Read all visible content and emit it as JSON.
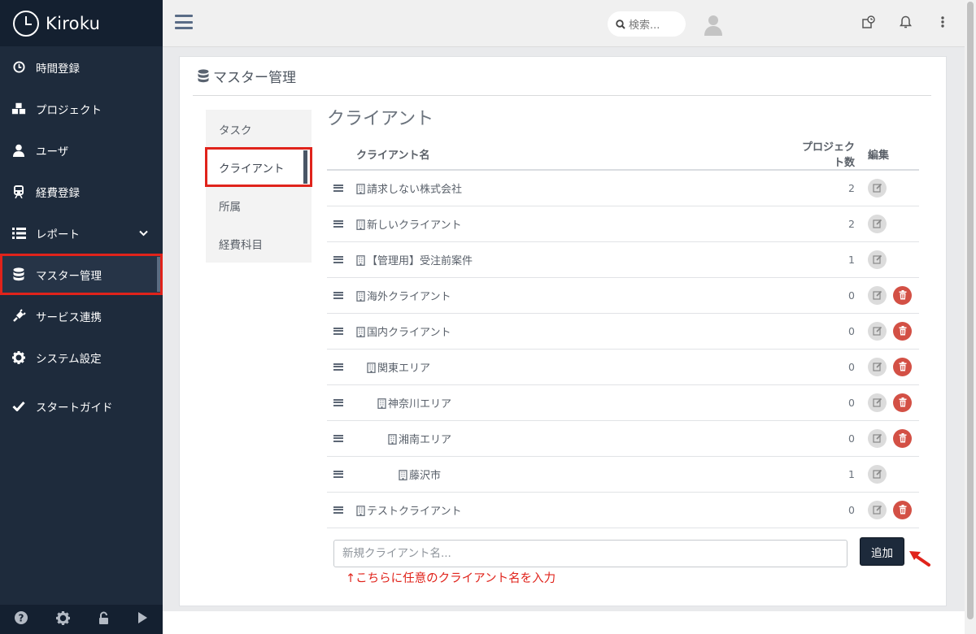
{
  "app": {
    "name": "Kiroku"
  },
  "sidebar": {
    "items": [
      {
        "label": "時間登録",
        "icon": "clock-icon"
      },
      {
        "label": "プロジェクト",
        "icon": "cubes-icon"
      },
      {
        "label": "ユーザ",
        "icon": "user-icon"
      },
      {
        "label": "経費登録",
        "icon": "train-icon"
      },
      {
        "label": "レポート",
        "icon": "list-icon",
        "has_submenu": true
      },
      {
        "label": "マスター管理",
        "icon": "database-icon",
        "active": true
      },
      {
        "label": "サービス連携",
        "icon": "plug-icon"
      },
      {
        "label": "システム設定",
        "icon": "gear-icon"
      },
      {
        "label": "スタートガイド",
        "icon": "check-icon"
      }
    ],
    "footer_icons": [
      "help-icon",
      "gear-icon",
      "unlock-icon",
      "play-icon"
    ]
  },
  "topbar": {
    "search_placeholder": "検索...",
    "icons": [
      "hamburger-icon",
      "search-icon",
      "user-avatar-icon",
      "task-icon",
      "bell-icon",
      "more-icon"
    ]
  },
  "page": {
    "title": "マスター管理",
    "tabs": [
      {
        "label": "タスク"
      },
      {
        "label": "クライアント",
        "active": true
      },
      {
        "label": "所属"
      },
      {
        "label": "経費科目"
      }
    ],
    "section_title": "クライアント",
    "table": {
      "columns": [
        "クライアント名",
        "プロジェクト数",
        "編集"
      ],
      "rows": [
        {
          "name": "請求しない株式会社",
          "count": "2",
          "level": 0,
          "deletable": false
        },
        {
          "name": "新しいクライアント",
          "count": "2",
          "level": 0,
          "deletable": false
        },
        {
          "name": "【管理用】受注前案件",
          "count": "1",
          "level": 0,
          "deletable": false
        },
        {
          "name": "海外クライアント",
          "count": "0",
          "level": 0,
          "deletable": true
        },
        {
          "name": "国内クライアント",
          "count": "0",
          "level": 0,
          "deletable": true
        },
        {
          "name": "関東エリア",
          "count": "0",
          "level": 1,
          "deletable": true
        },
        {
          "name": "神奈川エリア",
          "count": "0",
          "level": 2,
          "deletable": true
        },
        {
          "name": "湘南エリア",
          "count": "0",
          "level": 3,
          "deletable": true
        },
        {
          "name": "藤沢市",
          "count": "1",
          "level": 4,
          "deletable": false
        },
        {
          "name": "テストクライアント",
          "count": "0",
          "level": 0,
          "deletable": true
        }
      ]
    },
    "add_placeholder": "新規クライアント名...",
    "add_button": "追加",
    "annotation": "↑こちらに任意のクライアント名を入力"
  },
  "colors": {
    "sidebar_bg": "#1e2b3c",
    "highlight": "#e0231b",
    "delete_button": "#d35045"
  }
}
